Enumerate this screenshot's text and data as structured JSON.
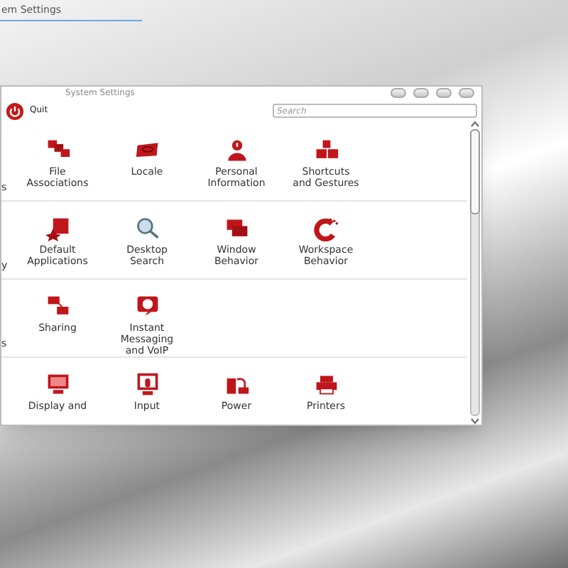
{
  "desktop": {
    "task_title": "em Settings"
  },
  "window": {
    "title": "System Settings",
    "toolbar": {
      "quit": "Quit",
      "search": {
        "placeholder": "Search"
      }
    }
  },
  "rows": [
    {
      "cut_label": "s",
      "items": [
        "File\nAssociations",
        "Locale",
        "Personal\nInformation",
        "Shortcuts\nand Gestures"
      ]
    },
    {
      "cut_label": "y",
      "items": [
        "Default\nApplications",
        "Desktop\nSearch",
        "Window\nBehavior",
        "Workspace\nBehavior"
      ]
    },
    {
      "cut_label": "s",
      "items": [
        "Sharing",
        "Instant\nMessaging\nand VoIP"
      ]
    },
    {
      "cut_label": "",
      "items": [
        "Display and",
        "Input",
        "Power",
        "Printers"
      ]
    }
  ]
}
